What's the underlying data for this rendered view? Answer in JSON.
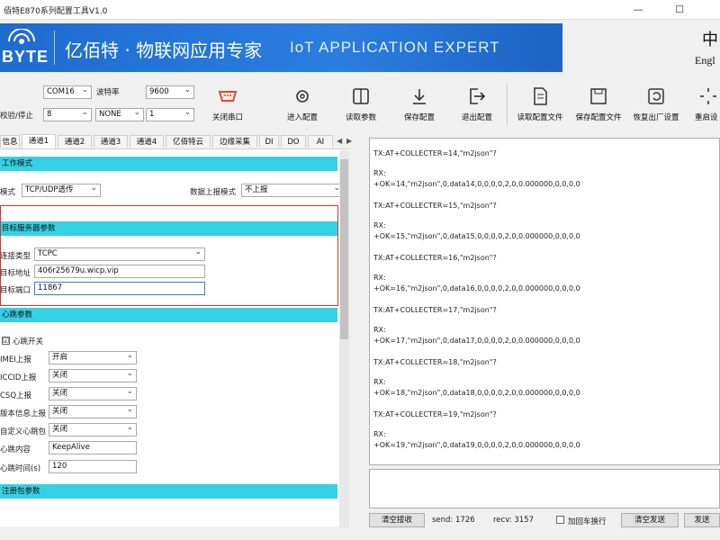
{
  "window": {
    "title": "佰特E870系列配置工具V1.0"
  },
  "banner": {
    "logo": "BYTE",
    "slogan_cn": "亿佰特 · 物联网应用专家",
    "slogan_en": "IoT APPLICATION EXPERT",
    "brand_color": "#2a7ee0"
  },
  "language": {
    "label": "Engl"
  },
  "serial": {
    "port_value": "COM16",
    "baud_label": "波特率",
    "baud_value": "9600",
    "check_label": "校验/停止",
    "data_bits": "8",
    "parity": "NONE",
    "stop_bits": "1",
    "close_label": "关闭串口"
  },
  "toolbar": {
    "enter_config": "进入配置",
    "read_params": "读取参数",
    "save_config": "保存配置",
    "exit_config": "退出配置",
    "read_file": "读取配置文件",
    "save_file": "保存配置文件",
    "factory_reset": "恢复出厂设置",
    "restart": "重启设"
  },
  "tabs": [
    "信息",
    "通道1",
    "通道2",
    "通道3",
    "通道4",
    "亿佰特云",
    "边缘采集",
    "DI",
    "DO",
    "AI"
  ],
  "work_mode": {
    "section": "工作模式",
    "mode_label": "模式",
    "mode_value": "TCP/UDP透传",
    "upload_label": "数据上报模式",
    "upload_value": "不上报"
  },
  "target": {
    "section": "目标服务器参数",
    "conn_type_label": "连接类型",
    "conn_type_value": "TCPC",
    "addr_label": "目标地址",
    "addr_value": "406r25679u.wicp.vip",
    "port_label": "目标端口",
    "port_value": "11867"
  },
  "heartbeat": {
    "section": "心跳参数",
    "switch_label": "心跳开关",
    "switch_checked": "☑",
    "rows": [
      {
        "label": "IMEI上报",
        "value": "开启"
      },
      {
        "label": "ICCID上报",
        "value": "关闭"
      },
      {
        "label": "CSQ上报",
        "value": "关闭"
      },
      {
        "label": "版本信息上报",
        "value": "关闭"
      },
      {
        "label": "自定义心跳包",
        "value": "关闭"
      }
    ],
    "content_label": "心跳内容",
    "content_value": "KeepAlive",
    "time_label": "心跳时间(s)",
    "time_value": "120"
  },
  "register": {
    "section": "注册包参数"
  },
  "log": [
    "TX:AT+COLLECTER=14,\"m2json\"?",
    "RX:",
    "+OK=14,\"m2json\",0,data14,0,0,0,0,2,0,0.000000,0,0,0,0",
    "TX:AT+COLLECTER=15,\"m2json\"?",
    "RX:",
    "+OK=15,\"m2json\",0,data15,0,0,0,0,2,0,0.000000,0,0,0,0",
    "TX:AT+COLLECTER=16,\"m2json\"?",
    "RX:",
    "+OK=16,\"m2json\",0,data16,0,0,0,0,2,0,0.000000,0,0,0,0",
    "TX:AT+COLLECTER=17,\"m2json\"?",
    "RX:",
    "+OK=17,\"m2json\",0,data17,0,0,0,0,2,0,0.000000,0,0,0,0",
    "TX:AT+COLLECTER=18,\"m2json\"?",
    "RX:",
    "+OK=18,\"m2json\",0,data18,0,0,0,0,2,0,0.000000,0,0,0,0",
    "TX:AT+COLLECTER=19,\"m2json\"?",
    "RX:",
    "+OK=19,\"m2json\",0,data19,0,0,0,0,2,0,0.000000,0,0,0,0"
  ],
  "bottom": {
    "clear_recv": "清空接收",
    "send_count": "send: 1726",
    "recv_count": "recv: 3157",
    "newline_label": "加回车换行",
    "clear_send": "清空发送",
    "send": "发送"
  }
}
